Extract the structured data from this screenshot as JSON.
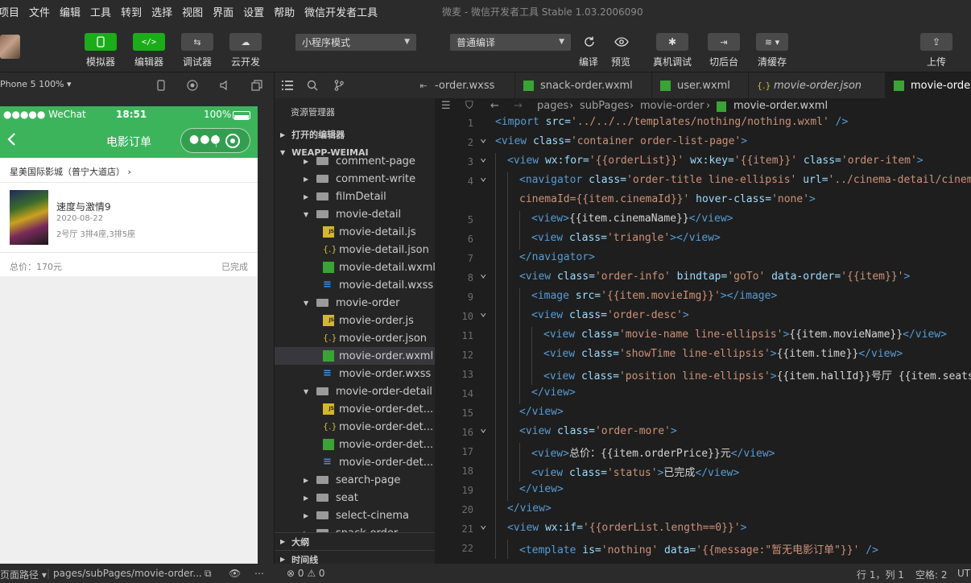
{
  "menu": [
    "项目",
    "文件",
    "编辑",
    "工具",
    "转到",
    "选择",
    "视图",
    "界面",
    "设置",
    "帮助",
    "微信开发者工具"
  ],
  "window_title": "微麦 - 微信开发者工具 Stable 1.03.2006090",
  "toolbar": {
    "simulator": "模拟器",
    "editor": "编辑器",
    "debugger": "调试器",
    "cloud": "云开发",
    "mode_select": "小程序模式",
    "compile_select": "普通编译",
    "compile": "编译",
    "preview": "预览",
    "real_debug": "真机调试",
    "background": "切后台",
    "clear_cache": "清缓存",
    "upload": "上传"
  },
  "simulator": {
    "device": "Phone 5 100% ▾",
    "status": {
      "carrier": "●●●●● WeChat",
      "time": "18:51",
      "battery": "100%"
    },
    "nav_title": "电影订单",
    "order": {
      "cinema": "星美国际影城（普宁大道店） ›",
      "movie_name": "速度与激情9",
      "time": "2020-08-22",
      "seats": "2号厅 3排4座,3排5座",
      "price": "总价：170元",
      "status": "已完成"
    }
  },
  "explorer": {
    "title": "资源管理器",
    "open_editors": "打开的编辑器",
    "project": "WEAPP-WEIMAI",
    "outline": "大纲",
    "timeline": "时间线",
    "items": [
      {
        "name": "comment-page",
        "type": "folder",
        "depth": 1,
        "expanded": false
      },
      {
        "name": "comment-write",
        "type": "folder",
        "depth": 1,
        "expanded": false
      },
      {
        "name": "filmDetail",
        "type": "folder",
        "depth": 1,
        "expanded": false
      },
      {
        "name": "movie-detail",
        "type": "folder",
        "depth": 1,
        "expanded": true
      },
      {
        "name": "movie-detail.js",
        "type": "js",
        "depth": 2
      },
      {
        "name": "movie-detail.json",
        "type": "json",
        "depth": 2
      },
      {
        "name": "movie-detail.wxml",
        "type": "wxml",
        "depth": 2
      },
      {
        "name": "movie-detail.wxss",
        "type": "wxss",
        "depth": 2
      },
      {
        "name": "movie-order",
        "type": "folder",
        "depth": 1,
        "expanded": true
      },
      {
        "name": "movie-order.js",
        "type": "js",
        "depth": 2
      },
      {
        "name": "movie-order.json",
        "type": "json",
        "depth": 2
      },
      {
        "name": "movie-order.wxml",
        "type": "wxml",
        "depth": 2,
        "active": true
      },
      {
        "name": "movie-order.wxss",
        "type": "wxss",
        "depth": 2
      },
      {
        "name": "movie-order-detail",
        "type": "folder",
        "depth": 1,
        "expanded": true
      },
      {
        "name": "movie-order-det...",
        "type": "js",
        "depth": 2
      },
      {
        "name": "movie-order-det...",
        "type": "json",
        "depth": 2
      },
      {
        "name": "movie-order-det...",
        "type": "wxml",
        "depth": 2
      },
      {
        "name": "movie-order-det...",
        "type": "wxss",
        "depth": 2
      },
      {
        "name": "search-page",
        "type": "folder",
        "depth": 1,
        "expanded": false
      },
      {
        "name": "seat",
        "type": "folder",
        "depth": 1,
        "expanded": false
      },
      {
        "name": "select-cinema",
        "type": "folder",
        "depth": 1,
        "expanded": false
      },
      {
        "name": "snack-order",
        "type": "folder",
        "depth": 1,
        "expanded": false
      }
    ]
  },
  "tabs": [
    {
      "name": "-order.wxss",
      "type": "wxss"
    },
    {
      "name": "snack-order.wxml",
      "type": "wxml"
    },
    {
      "name": "user.wxml",
      "type": "wxml"
    },
    {
      "name": "movie-order.json",
      "type": "json"
    },
    {
      "name": "movie-orde",
      "type": "wxml",
      "active": true
    }
  ],
  "breadcrumb": [
    "pages",
    "subPages",
    "movie-order",
    "movie-order.wxml"
  ],
  "code": [
    {
      "n": "1",
      "fold": false,
      "indent": 0,
      "parts": [
        [
          "tag",
          "<import "
        ],
        [
          "attr",
          "src="
        ],
        [
          "str",
          "'../../../templates/nothing/nothing.wxml'"
        ],
        [
          "tag",
          " />"
        ]
      ]
    },
    {
      "n": "2",
      "fold": true,
      "indent": 0,
      "parts": [
        [
          "tag",
          "<view "
        ],
        [
          "attr",
          "class="
        ],
        [
          "str",
          "'container order-list-page'"
        ],
        [
          "tag",
          ">"
        ]
      ]
    },
    {
      "n": "3",
      "fold": true,
      "indent": 1,
      "parts": [
        [
          "tag",
          "<view "
        ],
        [
          "attr",
          "wx:for="
        ],
        [
          "str",
          "'{{orderList}}'"
        ],
        [
          "attr",
          " wx:key="
        ],
        [
          "str",
          "'{{item}}'"
        ],
        [
          "attr",
          " class="
        ],
        [
          "str",
          "'order-item'"
        ],
        [
          "tag",
          ">"
        ]
      ]
    },
    {
      "n": "4",
      "fold": true,
      "indent": 2,
      "parts": [
        [
          "tag",
          "<navigator "
        ],
        [
          "attr",
          "class="
        ],
        [
          "str",
          "'order-title line-ellipsis'"
        ],
        [
          "attr",
          " url="
        ],
        [
          "str",
          "'../cinema-detail/cinema"
        ]
      ]
    },
    {
      "n": "",
      "fold": false,
      "indent": 2,
      "parts": [
        [
          "str",
          "cinemaId={{item.cinemaId}}'"
        ],
        [
          "attr",
          " hover-class="
        ],
        [
          "str",
          "'none'"
        ],
        [
          "tag",
          ">"
        ]
      ]
    },
    {
      "n": "5",
      "fold": false,
      "indent": 3,
      "parts": [
        [
          "tag",
          "<view>"
        ],
        [
          "mus",
          "{{item.cinemaName}}"
        ],
        [
          "tag",
          "</view>"
        ]
      ]
    },
    {
      "n": "6",
      "fold": false,
      "indent": 3,
      "parts": [
        [
          "tag",
          "<view "
        ],
        [
          "attr",
          "class="
        ],
        [
          "str",
          "'triangle'"
        ],
        [
          "tag",
          "></view>"
        ]
      ]
    },
    {
      "n": "7",
      "fold": false,
      "indent": 2,
      "parts": [
        [
          "tag",
          "</navigator>"
        ]
      ]
    },
    {
      "n": "8",
      "fold": true,
      "indent": 2,
      "parts": [
        [
          "tag",
          "<view "
        ],
        [
          "attr",
          "class="
        ],
        [
          "str",
          "'order-info'"
        ],
        [
          "attr",
          " bindtap="
        ],
        [
          "str",
          "'goTo'"
        ],
        [
          "attr",
          " data-order="
        ],
        [
          "str",
          "'{{item}}'"
        ],
        [
          "tag",
          ">"
        ]
      ]
    },
    {
      "n": "9",
      "fold": false,
      "indent": 3,
      "parts": [
        [
          "tag",
          "<image "
        ],
        [
          "attr",
          "src="
        ],
        [
          "str",
          "'{{item.movieImg}}'"
        ],
        [
          "tag",
          "></image>"
        ]
      ]
    },
    {
      "n": "10",
      "fold": true,
      "indent": 3,
      "parts": [
        [
          "tag",
          "<view "
        ],
        [
          "attr",
          "class="
        ],
        [
          "str",
          "'order-desc'"
        ],
        [
          "tag",
          ">"
        ]
      ]
    },
    {
      "n": "11",
      "fold": false,
      "indent": 4,
      "parts": [
        [
          "tag",
          "<view "
        ],
        [
          "attr",
          "class="
        ],
        [
          "str",
          "'movie-name line-ellipsis'"
        ],
        [
          "tag",
          ">"
        ],
        [
          "mus",
          "{{item.movieName}}"
        ],
        [
          "tag",
          "</view>"
        ]
      ]
    },
    {
      "n": "12",
      "fold": false,
      "indent": 4,
      "parts": [
        [
          "tag",
          "<view "
        ],
        [
          "attr",
          "class="
        ],
        [
          "str",
          "'showTime line-ellipsis'"
        ],
        [
          "tag",
          ">"
        ],
        [
          "mus",
          "{{item.time}}"
        ],
        [
          "tag",
          "</view>"
        ]
      ]
    },
    {
      "n": "13",
      "fold": false,
      "indent": 4,
      "parts": [
        [
          "tag",
          "<view "
        ],
        [
          "attr",
          "class="
        ],
        [
          "str",
          "'position line-ellipsis'"
        ],
        [
          "tag",
          ">"
        ],
        [
          "mus",
          "{{item.hallId}}"
        ],
        [
          "txt",
          "号厅 "
        ],
        [
          "mus",
          "{{item.seats"
        ]
      ]
    },
    {
      "n": "14",
      "fold": false,
      "indent": 3,
      "parts": [
        [
          "tag",
          "</view>"
        ]
      ]
    },
    {
      "n": "15",
      "fold": false,
      "indent": 2,
      "parts": [
        [
          "tag",
          "</view>"
        ]
      ]
    },
    {
      "n": "16",
      "fold": true,
      "indent": 2,
      "parts": [
        [
          "tag",
          "<view "
        ],
        [
          "attr",
          "class="
        ],
        [
          "str",
          "'order-more'"
        ],
        [
          "tag",
          ">"
        ]
      ]
    },
    {
      "n": "17",
      "fold": false,
      "indent": 3,
      "parts": [
        [
          "tag",
          "<view>"
        ],
        [
          "txt",
          "总价："
        ],
        [
          "mus",
          "{{item.orderPrice}}"
        ],
        [
          "txt",
          "元"
        ],
        [
          "tag",
          "</view>"
        ]
      ]
    },
    {
      "n": "18",
      "fold": false,
      "indent": 3,
      "parts": [
        [
          "tag",
          "<view "
        ],
        [
          "attr",
          "class="
        ],
        [
          "str",
          "'status'"
        ],
        [
          "tag",
          ">"
        ],
        [
          "txt",
          "已完成"
        ],
        [
          "tag",
          "</view>"
        ]
      ]
    },
    {
      "n": "19",
      "fold": false,
      "indent": 2,
      "parts": [
        [
          "tag",
          "</view>"
        ]
      ]
    },
    {
      "n": "20",
      "fold": false,
      "indent": 1,
      "parts": [
        [
          "tag",
          "</view>"
        ]
      ]
    },
    {
      "n": "21",
      "fold": true,
      "indent": 1,
      "parts": [
        [
          "tag",
          "<view "
        ],
        [
          "attr",
          "wx:if="
        ],
        [
          "str",
          "'{{orderList.length==0}}'"
        ],
        [
          "tag",
          ">"
        ]
      ]
    },
    {
      "n": "22",
      "fold": false,
      "indent": 2,
      "parts": [
        [
          "tag",
          "<template "
        ],
        [
          "attr",
          "is="
        ],
        [
          "str",
          "'nothing'"
        ],
        [
          "attr",
          " data="
        ],
        [
          "str",
          "'{{message:\"暂无电影订单\"}}'"
        ],
        [
          "tag",
          " />"
        ]
      ]
    }
  ],
  "statusbar": {
    "page_path_label": "页面路径 ▾",
    "page_path": "pages/subPages/movie-order...",
    "errors": "⊗ 0 ⚠ 0",
    "cursor": "行 1，列 1",
    "spaces": "空格: 2",
    "encoding": "UT"
  },
  "colors": {
    "wechat_green": "#1aad19",
    "nav_green": "#3cb45c",
    "editor_bg": "#1e1e1e",
    "panel_bg": "#2b2b2b",
    "tag": "#569cd6",
    "attr": "#9cdcfe",
    "string": "#ce9178"
  }
}
